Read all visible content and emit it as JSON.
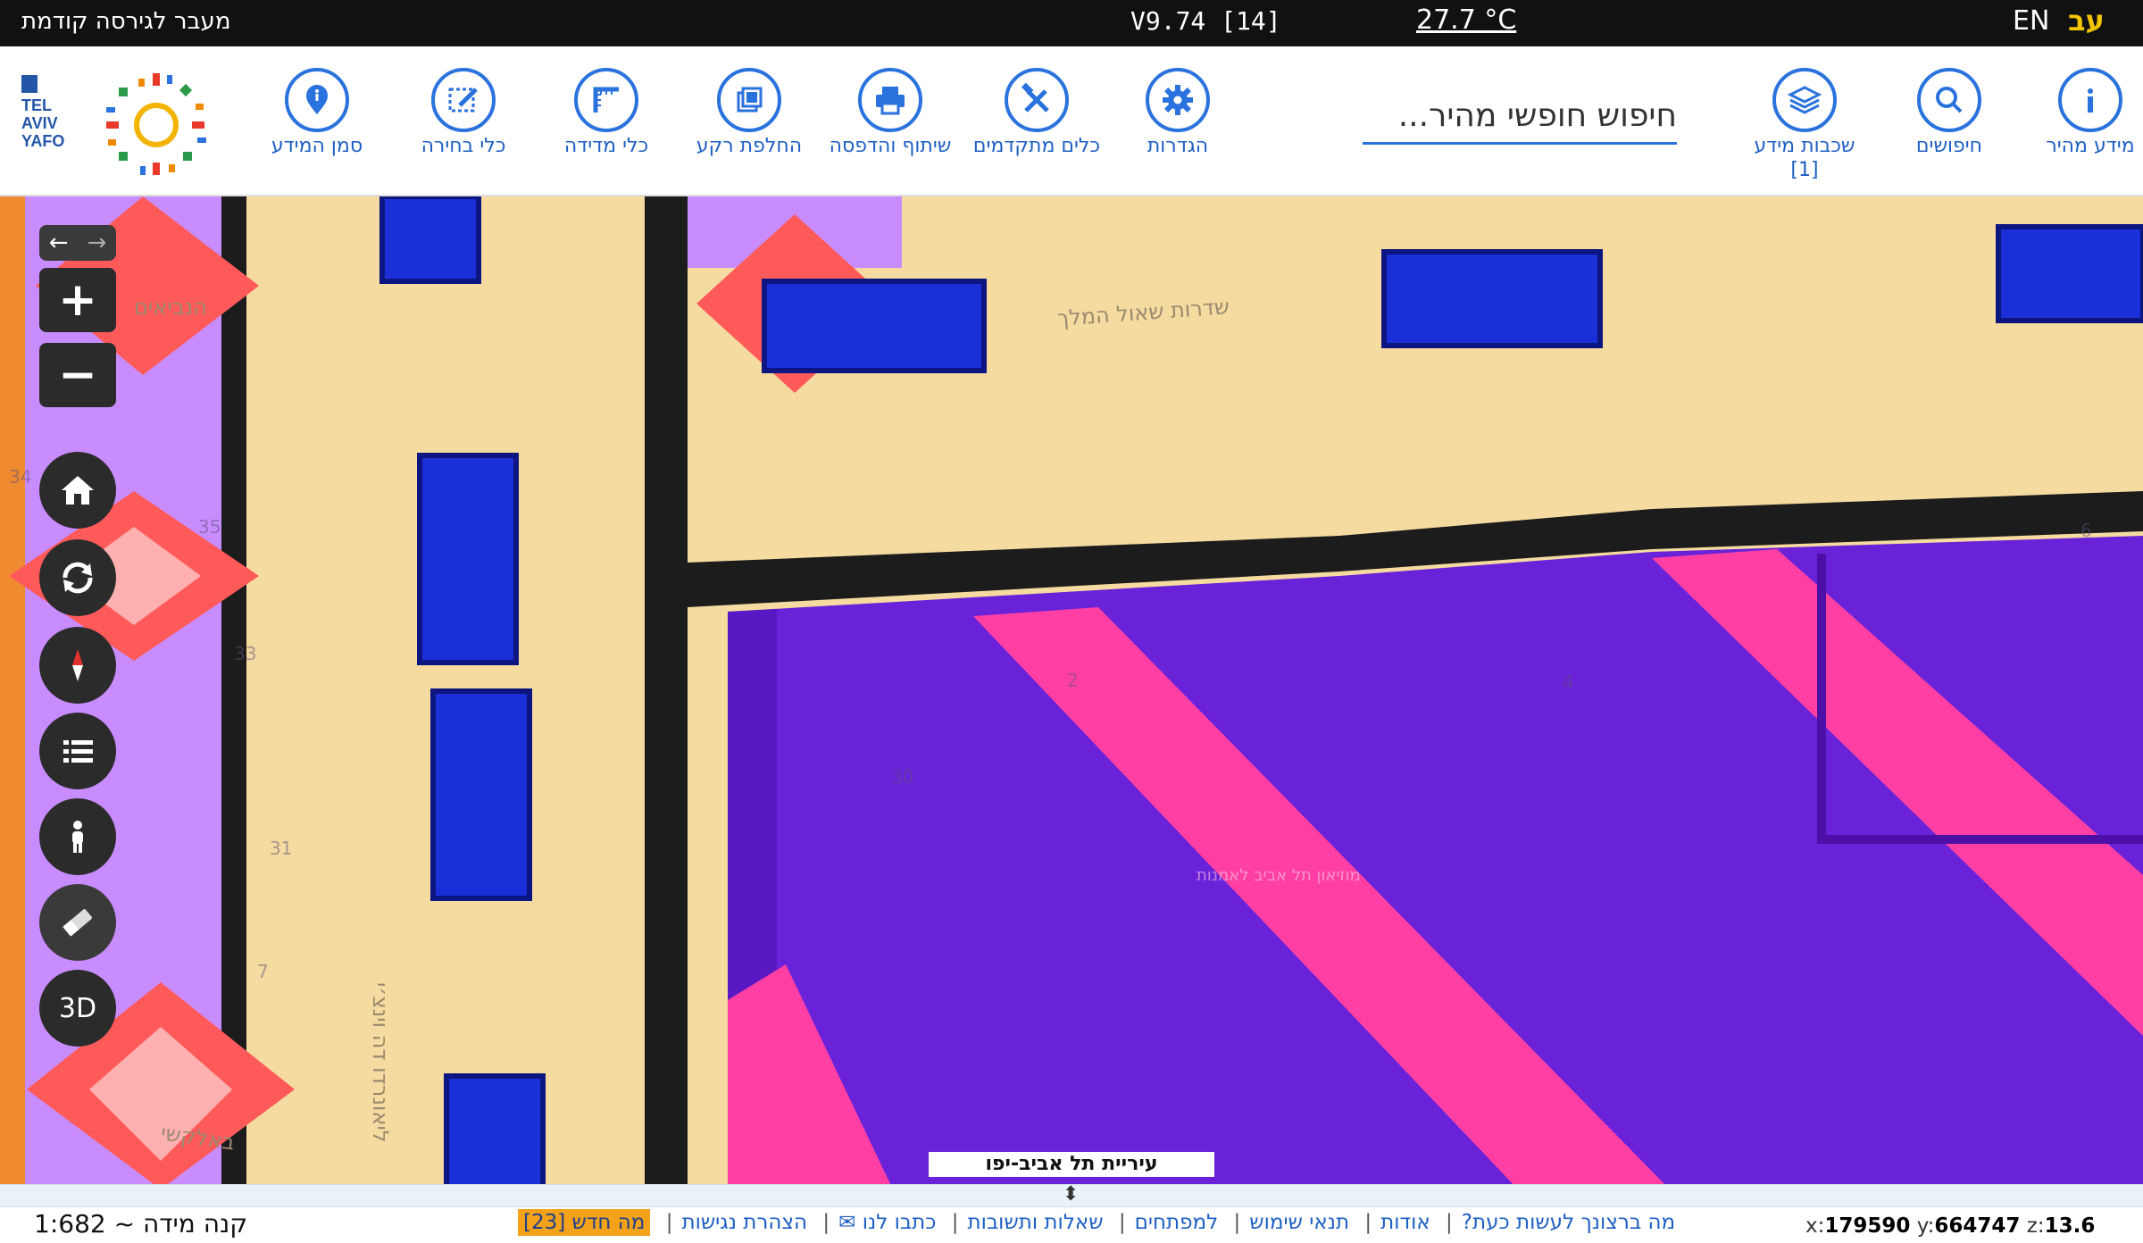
{
  "topbar": {
    "prev_version": "מעבר לגירסה קודמת",
    "version": "V9.74 [14]",
    "temperature": "27.7 °C",
    "lang_en": "EN",
    "lang_he": "עב"
  },
  "toolbar": {
    "search_placeholder": "חיפוש חופשי מהיר...",
    "logo_text": "TEL AVIV YAFO תל אביב יפו",
    "tools": [
      {
        "label": "מידע מהיר",
        "icon": "info-icon"
      },
      {
        "label": "חיפושים",
        "icon": "search-icon"
      },
      {
        "label": "שכבות מידע [1]",
        "icon": "layers-icon"
      },
      {
        "label": "הגדרות",
        "icon": "gear-icon"
      },
      {
        "label": "כלים מתקדמים",
        "icon": "tools-icon"
      },
      {
        "label": "שיתוף והדפסה",
        "icon": "print-icon"
      },
      {
        "label": "החלפת רקע",
        "icon": "basemap-icon"
      },
      {
        "label": "כלי מדידה",
        "icon": "ruler-icon"
      },
      {
        "label": "כלי בחירה",
        "icon": "select-icon"
      },
      {
        "label": "סמן המידע",
        "icon": "pin-icon"
      }
    ]
  },
  "map": {
    "street_labels": [
      "שדרות שאול המלך",
      "הנביאים",
      "ליאונרדו דה וינצ׳י",
      "באלקשי",
      "מוזיאון תל אביב לאמנות"
    ],
    "numbers": [
      "2",
      "4",
      "30",
      "31",
      "34",
      "35",
      "33",
      "6",
      "7"
    ],
    "attribution": "עיריית תל אביב-יפו",
    "colors": {
      "base": "#f5dba0",
      "purple": "#6a22d8",
      "pink": "#ff3fa4",
      "blue": "#1a2fd8",
      "red": "#ff5a5a",
      "lilac": "#c98cff",
      "dark": "#1c1c1c"
    }
  },
  "controls": {
    "arrow_back": "←",
    "arrow_forward": "→",
    "zoom_in": "+",
    "zoom_out": "−",
    "three_d": "3D"
  },
  "footer": {
    "scale": "קנה מידה ~ 1:682",
    "links": [
      "מה ברצונך לעשות כעת?",
      "אודות",
      "תנאי שימוש",
      "למפתחים",
      "שאלות ותשובות",
      "כתבו לנו ✉",
      "הצהרת נגישות"
    ],
    "whats_new": "מה חדש [23]",
    "coord_x_label": "x:",
    "coord_x": "179590",
    "coord_y_label": "y:",
    "coord_y": "664747",
    "coord_z_label": "z:",
    "coord_z": "13.6"
  }
}
